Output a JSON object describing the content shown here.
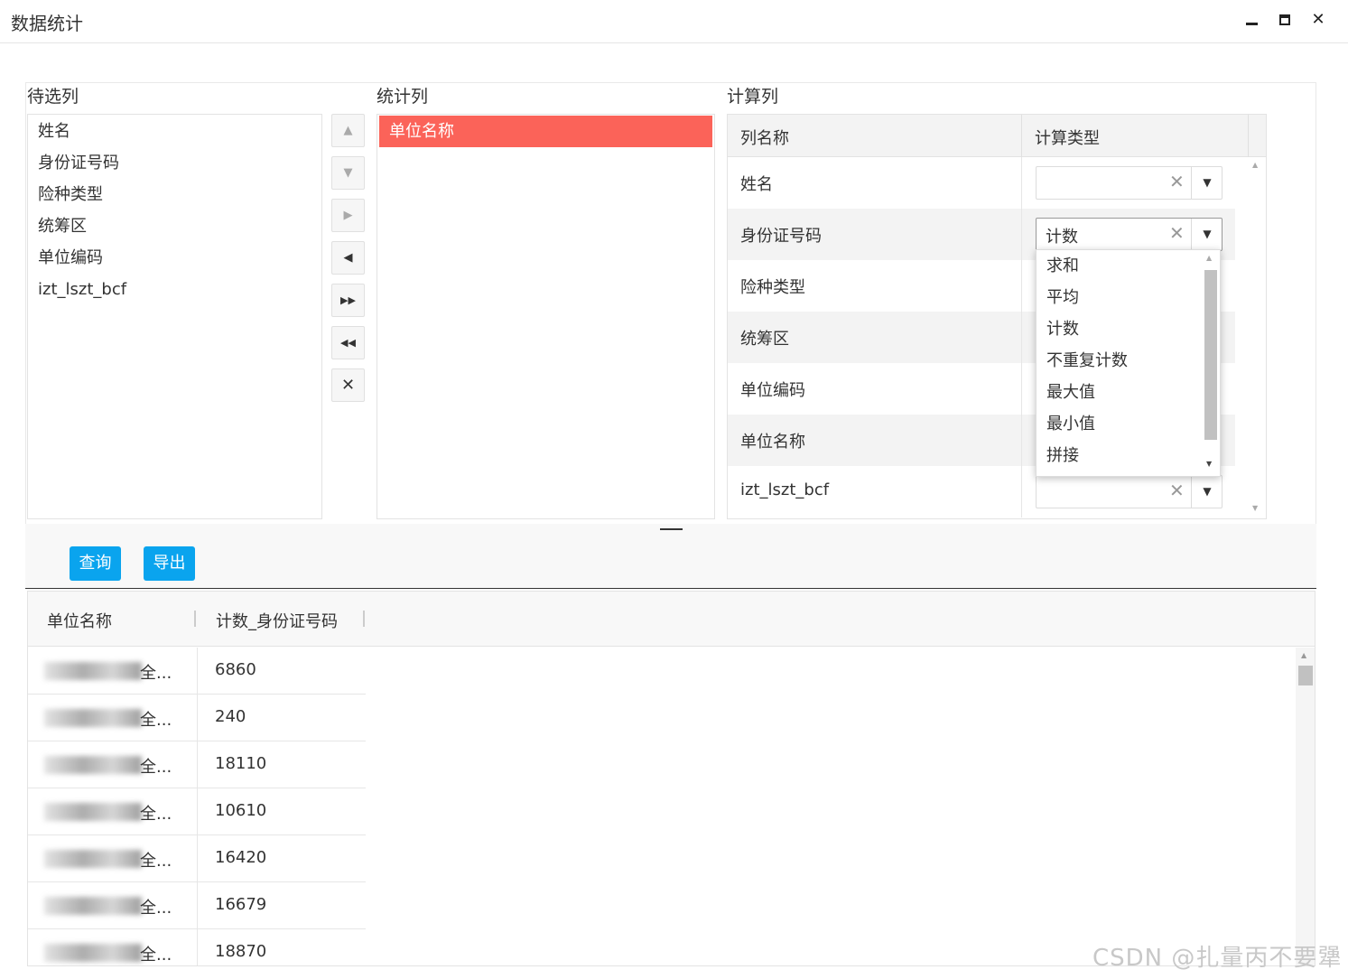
{
  "window": {
    "title": "数据统计",
    "controls": [
      "minimize",
      "maximize",
      "close"
    ]
  },
  "candidate": {
    "label": "待选列",
    "items": [
      "姓名",
      "身份证号码",
      "险种类型",
      "统筹区",
      "单位编码",
      "izt_lszt_bcf"
    ]
  },
  "move_buttons": [
    {
      "name": "move-up-button",
      "icon": "▲"
    },
    {
      "name": "move-down-button",
      "icon": "▼"
    },
    {
      "name": "move-right-button",
      "icon": "▶"
    },
    {
      "name": "move-left-button",
      "icon": "◀"
    },
    {
      "name": "move-all-right-button",
      "icon": "▶▶"
    },
    {
      "name": "move-all-left-button",
      "icon": "◀◀"
    },
    {
      "name": "clear-button",
      "icon": "✕"
    }
  ],
  "stat": {
    "label": "统计列",
    "items": [
      "单位名称"
    ],
    "selected_color": "#fb6359"
  },
  "calc": {
    "label": "计算列",
    "col_name_header": "列名称",
    "col_type_header": "计算类型",
    "rows": [
      {
        "name": "姓名",
        "type": ""
      },
      {
        "name": "身份证号码",
        "type": "计数"
      },
      {
        "name": "险种类型",
        "type": ""
      },
      {
        "name": "统筹区",
        "type": ""
      },
      {
        "name": "单位编码",
        "type": ""
      },
      {
        "name": "单位名称",
        "type": ""
      },
      {
        "name": "izt_lszt_bcf",
        "type": ""
      }
    ],
    "clear_glyph": "✕",
    "arrow_glyph": "▼"
  },
  "dropdown": {
    "options": [
      "求和",
      "平均",
      "计数",
      "不重复计数",
      "最大值",
      "最小值",
      "拼接"
    ]
  },
  "toolbar": {
    "query_label": "查询",
    "export_label": "导出",
    "accent": "#0aa4ee"
  },
  "result": {
    "headers": [
      "单位名称",
      "计数_身份证号码"
    ],
    "rows": [
      {
        "unit_suffix": "全...",
        "count": "6860"
      },
      {
        "unit_suffix": "全...",
        "count": "240"
      },
      {
        "unit_suffix": "全...",
        "count": "18110"
      },
      {
        "unit_suffix": "全...",
        "count": "10610"
      },
      {
        "unit_suffix": "全...",
        "count": "16420"
      },
      {
        "unit_suffix": "全...",
        "count": "16679"
      },
      {
        "unit_suffix": "全...",
        "count": "18870"
      }
    ]
  },
  "watermark": "CSDN @扎量丙不要犟"
}
